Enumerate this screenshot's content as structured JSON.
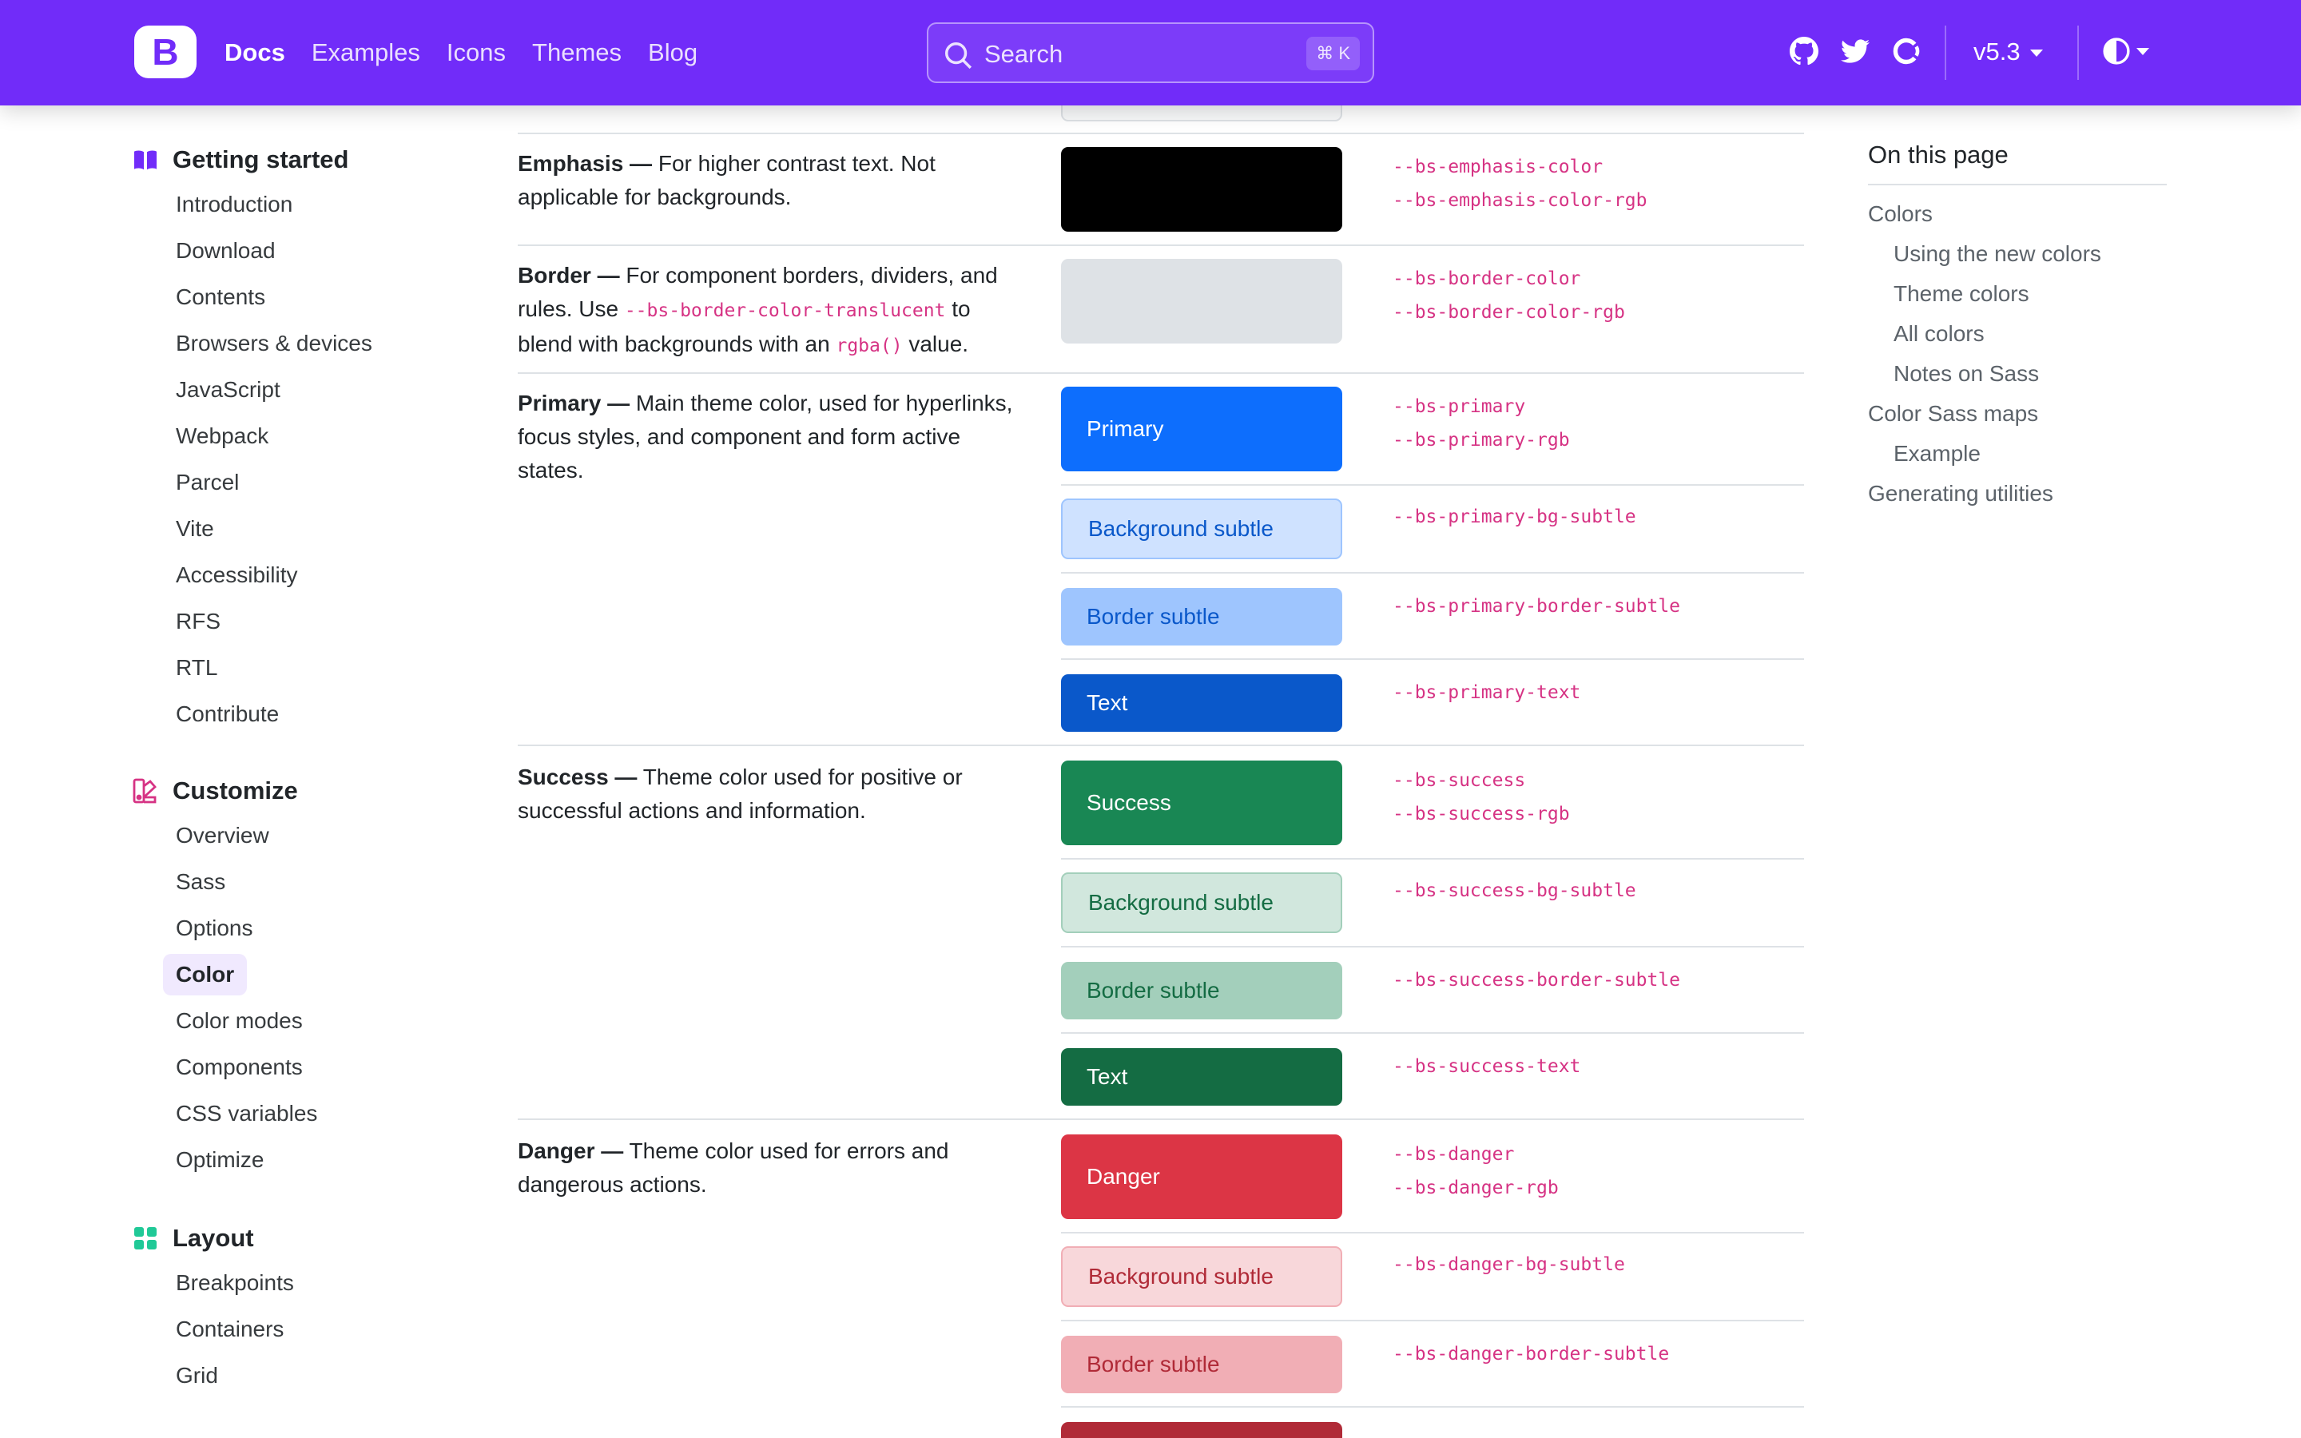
{
  "nav": {
    "brand": "B",
    "links": [
      {
        "label": "Docs",
        "active": true
      },
      {
        "label": "Examples",
        "active": false
      },
      {
        "label": "Icons",
        "active": false
      },
      {
        "label": "Themes",
        "active": false
      },
      {
        "label": "Blog",
        "active": false
      }
    ],
    "search_placeholder": "Search",
    "search_shortcut": "⌘ K",
    "version": "v5.3",
    "icons": [
      "github-icon",
      "twitter-icon",
      "opencollective-icon",
      "theme-toggle-icon"
    ],
    "accent_color": "#712cf9"
  },
  "sidebar": {
    "groups": [
      {
        "title": "Getting started",
        "icon": "book-icon",
        "icon_color": "#712cf9",
        "items": [
          "Introduction",
          "Download",
          "Contents",
          "Browsers & devices",
          "JavaScript",
          "Webpack",
          "Parcel",
          "Vite",
          "Accessibility",
          "RFS",
          "RTL",
          "Contribute"
        ]
      },
      {
        "title": "Customize",
        "icon": "palette-icon",
        "icon_color": "#d63384",
        "items": [
          "Overview",
          "Sass",
          "Options",
          "Color",
          "Color modes",
          "Components",
          "CSS variables",
          "Optimize"
        ],
        "active_item": "Color"
      },
      {
        "title": "Layout",
        "icon": "grid-icon",
        "icon_color": "#20c997",
        "items": [
          "Breakpoints",
          "Containers",
          "Grid"
        ]
      }
    ]
  },
  "table": {
    "emphasis": {
      "title": "Emphasis —",
      "text": "For higher contrast text. Not applicable for backgrounds.",
      "vars": [
        "--bs-emphasis-color",
        "--bs-emphasis-color-rgb"
      ]
    },
    "border": {
      "title": "Border —",
      "text_before": "For component borders, dividers, and rules. Use",
      "code1": "--bs-border-color-translucent",
      "text_mid": "to blend with backgrounds with an",
      "code2": "rgba()",
      "text_after": "value.",
      "vars": [
        "--bs-border-color",
        "--bs-border-color-rgb"
      ]
    },
    "primary": {
      "title": "Primary —",
      "text": "Main theme color, used for hyperlinks, focus styles, and component and form active states.",
      "swatches": [
        "Primary",
        "Background subtle",
        "Border subtle",
        "Text"
      ],
      "vars": [
        "--bs-primary",
        "--bs-primary-rgb",
        "--bs-primary-bg-subtle",
        "--bs-primary-border-subtle",
        "--bs-primary-text"
      ]
    },
    "success": {
      "title": "Success —",
      "text": "Theme color used for positive or successful actions and information.",
      "swatches": [
        "Success",
        "Background subtle",
        "Border subtle",
        "Text"
      ],
      "vars": [
        "--bs-success",
        "--bs-success-rgb",
        "--bs-success-bg-subtle",
        "--bs-success-border-subtle",
        "--bs-success-text"
      ]
    },
    "danger": {
      "title": "Danger —",
      "text": "Theme color used for errors and dangerous actions.",
      "swatches": [
        "Danger",
        "Background subtle",
        "Border subtle"
      ],
      "vars": [
        "--bs-danger",
        "--bs-danger-rgb",
        "--bs-danger-bg-subtle",
        "--bs-danger-border-subtle"
      ]
    },
    "colors": {
      "emphasis": "#000000",
      "border": "#dee2e6",
      "primary": "#0d6efd",
      "primary_bg_subtle": "#cfe2ff",
      "primary_border_subtle": "#9ec5fe",
      "primary_text": "#0a58ca",
      "success": "#198754",
      "success_bg_subtle": "#d1e7dd",
      "success_border_subtle": "#a3cfbb",
      "success_text": "#146c43",
      "danger": "#dc3545",
      "danger_bg_subtle": "#f8d7da",
      "danger_border_subtle": "#f1aeb5",
      "danger_text": "#b02a37"
    }
  },
  "toc": {
    "title": "On this page",
    "items": [
      {
        "label": "Colors",
        "level": 1
      },
      {
        "label": "Using the new colors",
        "level": 2
      },
      {
        "label": "Theme colors",
        "level": 2
      },
      {
        "label": "All colors",
        "level": 2
      },
      {
        "label": "Notes on Sass",
        "level": 2
      },
      {
        "label": "Color Sass maps",
        "level": 1
      },
      {
        "label": "Example",
        "level": 2
      },
      {
        "label": "Generating utilities",
        "level": 1
      }
    ]
  }
}
